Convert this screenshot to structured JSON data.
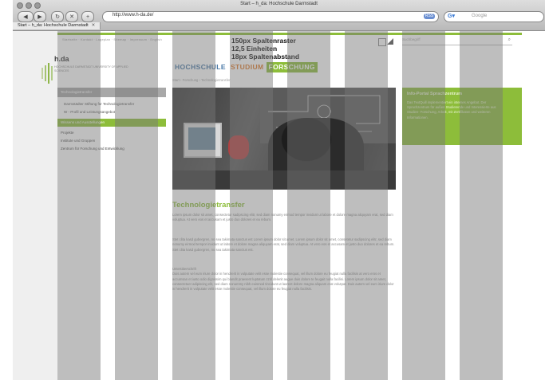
{
  "window": {
    "title": "Start – h_da: Hochschule Darmstadt",
    "url": "http://www.h-da.de/",
    "search_placeholder": "Google",
    "tab_label": "Start – h_da: Hochschule Darmstadt",
    "rss_label": "RSS"
  },
  "page": {
    "meta_nav": "Startseite  ·  Kontakt  ·  Lageplan  ·  Sitemap  ·  Impressum  ·  English",
    "logo": {
      "name": "h.da",
      "subtitle": "HOCHSCHULE DARMSTADT UNIVERSITY OF APPLIED SCIENCES"
    },
    "raster_note": {
      "line1": "150px Spaltenraster",
      "line2": "12,5 Einheiten",
      "line3": "18px Spaltenabstand"
    },
    "search_label": "Suchbegriff",
    "main_nav": {
      "hochschule": "HOCHSCHULE",
      "studium": "STUDIUM",
      "forschung": "FORSCHUNG"
    },
    "breadcrumb": "Start › Forschung › Technologietransfer",
    "sidebar": {
      "head": "Technologietransfer",
      "items": [
        "Darmstädter Stiftung für Technologietransfer",
        "W - Profil und Leistungsangebot"
      ],
      "active": "Wissens und Ausstellungen",
      "others": [
        "Projekte",
        "Institute und Gruppen",
        "Zentrum für Forschung und Entwicklung"
      ]
    },
    "content": {
      "title": "Technologietransfer",
      "p1": "Lorem ipsum dolor sit amet, consectetur sadipscing elitr, sed diam nonumy eirmod tempor invidunt ut labore et dolore magna aliquyam erat, sed diam voluptua. At vero eos et accusam et justo duo dolores et ea rebum.",
      "p2": "Stet clita kasd gubergren, no sea takimata sanctus est Lorem ipsum dolor sit amet. Lorem ipsum dolor sit amet, consetetur sadipscing elitr, sed diam nonumy eirmod tempor invidunt ut labore et dolore magna aliquyam erat, sed diam voluptua. At vero eos et accusam et justo duo dolores et ea rebum. Stet clita kasd gubergren, no sea takimata sanctus est.",
      "p3_head": "Unterüberschrift",
      "p3": "Duis autem vel eum iriure dolor in hendrerit in vulputate velit esse molestie consequat, vel illum dolore eu feugiat nulla facilisis at vero eros et accumsan et iusto odio dignissim qui blandit praesent luptatum zzril delenit augue duis dolore te feugait nulla facilisi. Lorem ipsum dolor sit amet, consectetuer adipiscing elit, sed diam nonummy nibh euismod tincidunt ut laoreet dolore magna aliquam erat volutpat. Duis autem vel eum iriure dolor in hendrerit in vulputate velit esse molestie consequat, vel illum dolore eu feugiat nulla facilisis."
    },
    "info_box": {
      "title": "Info-Portal Sprachzentrum",
      "text": "Das TextQuill impl­ementiert ein internes Angebot. Der Sprachzentrum für außen Studierende und Interessierte aus Studien- Forschung, Arbeit, mit Zertifikaten und weiteren Informationen."
    }
  },
  "colors": {
    "accent_green": "#8dbd3a",
    "hochschule_blue": "#4a7aa8",
    "studium_orange": "#e07a2a",
    "column_overlay": "#7a7a7a"
  }
}
